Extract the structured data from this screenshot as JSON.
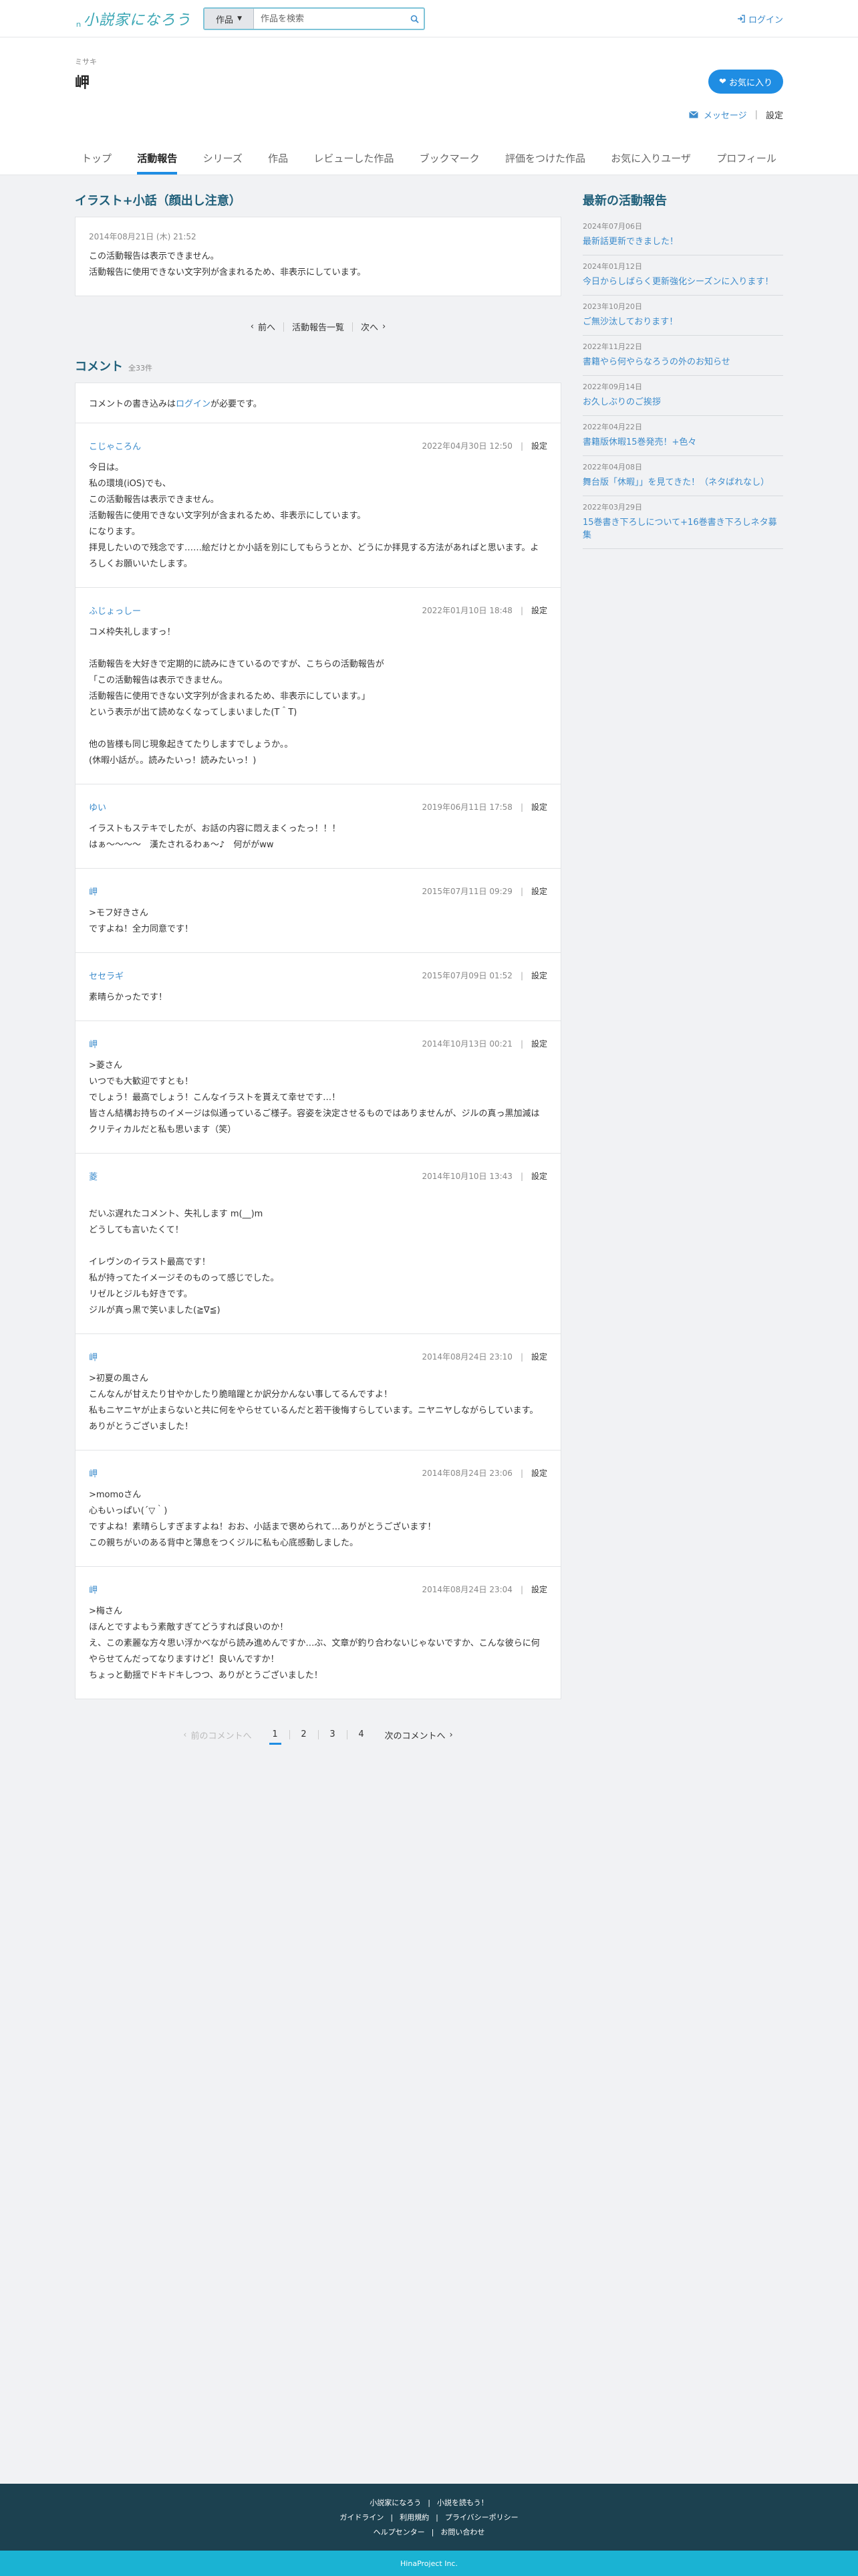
{
  "header": {
    "logo_small": "ｎ",
    "logo_big": "小説家になろう",
    "search_select": "作品",
    "search_placeholder": "作品を検索",
    "login": "ログイン"
  },
  "profile": {
    "kana": "ミサキ",
    "name": "岬",
    "favorite_button": "お気に入り",
    "message": "メッセージ",
    "settings": "設定",
    "tabs": [
      {
        "label": "トップ"
      },
      {
        "label": "活動報告"
      },
      {
        "label": "シリーズ"
      },
      {
        "label": "作品"
      },
      {
        "label": "レビューした作品"
      },
      {
        "label": "ブックマーク"
      },
      {
        "label": "評価をつけた作品"
      },
      {
        "label": "お気に入りユーザ"
      },
      {
        "label": "プロフィール"
      }
    ],
    "active_tab": 1
  },
  "report": {
    "title": "イラスト+小話（顔出し注意）",
    "date": "2014年08月21日 (木) 21:52",
    "line1": "この活動報告は表示できません。",
    "line2": "活動報告に使用できない文字列が含まれるため、非表示にしています。"
  },
  "report_pager": {
    "prev": "前へ",
    "list": "活動報告一覧",
    "next": "次へ"
  },
  "comments_section": {
    "title": "コメント",
    "count": "全33件",
    "note_prefix": "コメントの書き込みは",
    "note_link": "ログイン",
    "note_suffix": "が必要です。",
    "settings_label": "設定"
  },
  "comments": [
    {
      "author": "こじゃころん",
      "date": "2022年04月30日 12:50",
      "body": "今日は。\n私の環境(iOS)でも、\nこの活動報告は表示できません。\n活動報告に使用できない文字列が含まれるため、非表示にしています。\nになります。\n拝見したいので残念です……絵だけとか小話を別にしてもらうとか、どうにか拝見する方法があればと思います。よろしくお願いいたします。"
    },
    {
      "author": "ふじょっしー",
      "date": "2022年01月10日 18:48",
      "body": "コメ枠失礼しますっ！\n\n活動報告を大好きで定期的に読みにきているのですが、こちらの活動報告が\n「この活動報告は表示できません。\n活動報告に使用できない文字列が含まれるため、非表示にしています。」\nという表示が出て読めなくなってしまいました(T＾T)\n\n他の皆様も同じ現象起きてたりしますでしょうか。。\n(休暇小話が。。読みたいっ！読みたいっ！)"
    },
    {
      "author": "ゆい",
      "date": "2019年06月11日 17:58",
      "body": "イラストもステキでしたが、お話の内容に悶えまくったっ！！！\nはぁ〜〜〜〜　漢たされるわぁ〜♪　何ががww"
    },
    {
      "author": "岬",
      "date": "2015年07月11日 09:29",
      "body": ">モフ好きさん\nですよね！全力同意です！"
    },
    {
      "author": "セセラギ",
      "date": "2015年07月09日 01:52",
      "body": "素晴らかったです！"
    },
    {
      "author": "岬",
      "date": "2014年10月13日 00:21",
      "body": ">菱さん\nいつでも大歓迎ですとも！\nでしょう！最高でしょう！こんなイラストを貰えて幸せです…！\n皆さん結構お持ちのイメージは似通っているご様子。容姿を決定させるものではありませんが、ジルの真っ黒加減はクリティカルだと私も思います（笑）"
    },
    {
      "author": "菱",
      "date": "2014年10月10日 13:43",
      "body": "\nだいぶ遅れたコメント、失礼します m(__)m\nどうしても言いたくて！\n\nイレヴンのイラスト最高です！\n私が持ってたイメージそのものって感じでした。\nリゼルとジルも好きです。\nジルが真っ黒で笑いました(≧∇≦)"
    },
    {
      "author": "岬",
      "date": "2014年08月24日 23:10",
      "body": ">初夏の風さん\nこんなんが甘えたり甘やかしたり脆暗躍とか訳分かんない事してるんですよ！\n私もニヤニヤが止まらないと共に何をやらせているんだと若干後悔すらしています。ニヤニヤしながらしています。\nありがとうございました！"
    },
    {
      "author": "岬",
      "date": "2014年08月24日 23:06",
      "body": ">momoさん\n心もいっぱい(´▽｀)\nですよね！素晴らしすぎますよね！おお、小話まで褒められて…ありがとうございます！\nこの親ちがいのある背中と薄息をつくジルに私も心底感動しました。"
    },
    {
      "author": "岬",
      "date": "2014年08月24日 23:04",
      "body": ">梅さん\nほんとですよもう素敵すぎてどうすれば良いのか！\nえ、この素麗な方々思い浮かべながら読み進めんですか…ぶ、文章が釣り合わないじゃないですか、こんな彼らに何やらせてんだってなりますけど！良いんですか！\nちょっと動揺でドキドキしつつ、ありがとうございました！"
    }
  ],
  "comment_pager": {
    "prev": "前のコメントへ",
    "pages": [
      "1",
      "2",
      "3",
      "4"
    ],
    "active": 0,
    "next": "次のコメントへ"
  },
  "aside": {
    "title": "最新の活動報告",
    "items": [
      {
        "date": "2024年07月06日",
        "label": "最新話更新できました！"
      },
      {
        "date": "2024年01月12日",
        "label": "今日からしばらく更新強化シーズンに入ります！"
      },
      {
        "date": "2023年10月20日",
        "label": "ご無沙汰しております！"
      },
      {
        "date": "2022年11月22日",
        "label": "書籍やら何やらなろうの外のお知らせ"
      },
      {
        "date": "2022年09月14日",
        "label": "お久しぶりのご挨拶"
      },
      {
        "date": "2022年04月22日",
        "label": "書籍版休暇15巻発売！+色々"
      },
      {
        "date": "2022年04月08日",
        "label": "舞台版「休暇」」を見てきた！（ネタばれなし）"
      },
      {
        "date": "2022年03月29日",
        "label": "15巻書き下ろしについて+16巻書き下ろしネタ募集"
      }
    ]
  },
  "footer": {
    "links1": [
      "小説家になろう",
      "小説を読もう！"
    ],
    "links2": [
      "ガイドライン",
      "利用規約",
      "プライバシーポリシー"
    ],
    "links3": [
      "ヘルプセンター",
      "お問い合わせ"
    ],
    "copyright": "HinaProject Inc."
  },
  "colors": {
    "accent": "#1f8de3",
    "link": "#3d8ccc",
    "heading": "#1f5f7a",
    "footer_bg": "#1c4150",
    "copyright_bg": "#1ab3d3"
  }
}
